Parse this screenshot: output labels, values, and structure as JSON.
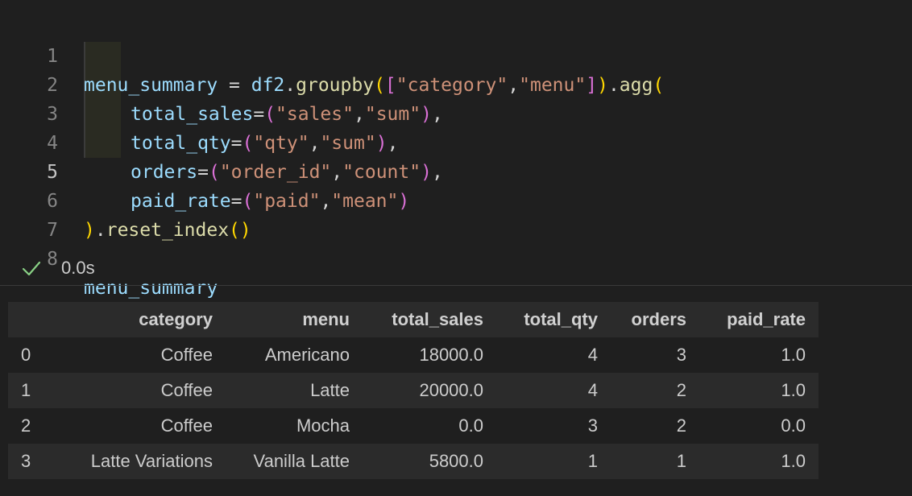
{
  "editor": {
    "active_line": 5,
    "lines": [
      {
        "no": "1"
      },
      {
        "no": "2"
      },
      {
        "no": "3"
      },
      {
        "no": "4"
      },
      {
        "no": "5"
      },
      {
        "no": "6"
      },
      {
        "no": "7"
      },
      {
        "no": "8"
      }
    ],
    "tokens": {
      "l1_var": "menu_summary",
      "l1_eq": " = ",
      "l1_df": "df2",
      "l1_dot": ".",
      "l1_groupby": "groupby",
      "l1_p1": "(",
      "l1_b1": "[",
      "l1_s1": "\"category\"",
      "l1_comma": ",",
      "l1_s2": "\"menu\"",
      "l1_b2": "]",
      "l1_p2": ")",
      "l1_dot2": ".",
      "l1_agg": "agg",
      "l1_p3": "(",
      "l2_name": "total_sales",
      "l2_eq": "=",
      "l2_po": "(",
      "l2_s1": "\"sales\"",
      "l2_c": ",",
      "l2_s2": "\"sum\"",
      "l2_pc": ")",
      "l2_tail": ",",
      "l3_name": "total_qty",
      "l3_eq": "=",
      "l3_po": "(",
      "l3_s1": "\"qty\"",
      "l3_c": ",",
      "l3_s2": "\"sum\"",
      "l3_pc": ")",
      "l3_tail": ",",
      "l4_name": "orders",
      "l4_eq": "=",
      "l4_po": "(",
      "l4_s1": "\"order_id\"",
      "l4_c": ",",
      "l4_s2": "\"count\"",
      "l4_pc": ")",
      "l4_tail": ",",
      "l5_name": "paid_rate",
      "l5_eq": "=",
      "l5_po": "(",
      "l5_s1": "\"paid\"",
      "l5_c": ",",
      "l5_s2": "\"mean\"",
      "l5_pc": ")",
      "l6_pc": ")",
      "l6_dot": ".",
      "l6_fn": "reset_index",
      "l6_call": "()",
      "l8_var": "menu_summary"
    }
  },
  "status": {
    "icon": "check-icon",
    "exec_time": "0.0s",
    "success_color": "#89d185"
  },
  "output": {
    "columns": [
      "",
      "category",
      "menu",
      "total_sales",
      "total_qty",
      "orders",
      "paid_rate"
    ],
    "rows": [
      [
        "0",
        "Coffee",
        "Americano",
        "18000.0",
        "4",
        "3",
        "1.0"
      ],
      [
        "1",
        "Coffee",
        "Latte",
        "20000.0",
        "4",
        "2",
        "1.0"
      ],
      [
        "2",
        "Coffee",
        "Mocha",
        "0.0",
        "3",
        "2",
        "0.0"
      ],
      [
        "3",
        "Latte Variations",
        "Vanilla Latte",
        "5800.0",
        "1",
        "1",
        "1.0"
      ]
    ]
  }
}
